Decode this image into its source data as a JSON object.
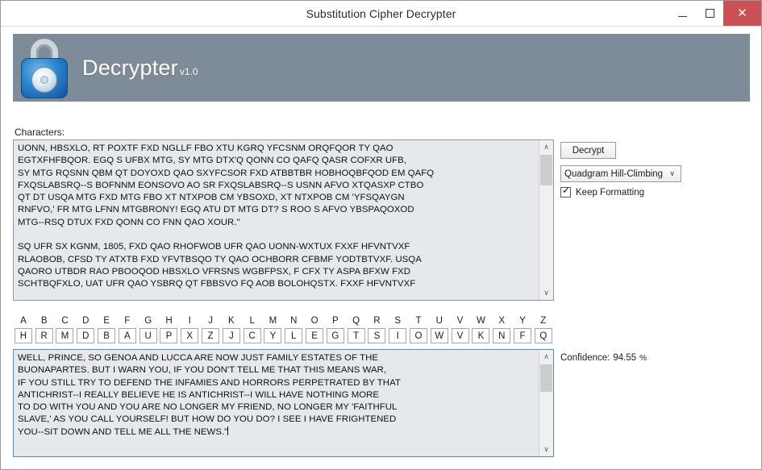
{
  "window": {
    "title": "Substitution Cipher Decrypter",
    "minimize_label": "–",
    "maximize_label": "",
    "close_label": "✕"
  },
  "banner": {
    "app_name": "Decrypter",
    "version": "v1.0",
    "bg_color": "#7e8c99",
    "lock_color": "#2b86cf"
  },
  "labels": {
    "characters": "Characters:"
  },
  "cipher": {
    "text": "UONN, HBSXLO, RT POXTF FXD NGLLF FBO XTU KGRQ YFCSNM ORQFQOR TY QAO\nEGTXFHFBQOR. EGQ S UFBX MTG, SY MTG DTX'Q QONN CO QAFQ QASR COFXR UFB,\nSY MTG RQSNN QBM QT DOYOXD QAO SXYFCSOR FXD ATBBTBR HOBHOQBFQOD EM QAFQ\nFXQSLABSRQ--S BOFNNM EONSOVO AO SR FXQSLABSRQ--S USNN AFVO XTQASXP CTBO\nQT DT USQA MTG FXD MTG FBO XT NTXPOB CM YBSOXD, XT NTXPOB CM 'YFSQAYGN\nRNFVO,' FR MTG LFNN MTGBRONY! EGQ ATU DT MTG DT? S ROO S AFVO YBSPAQOXOD\nMTG--RSQ DTUX FXD QONN CO FNN QAO XOUR.\"\n\nSQ UFR SX KGNM, 1805, FXD QAO RHOFWOB UFR QAO UONN-WXTUX FXXF HFVNTVXF\nRLAOBOB, CFSD TY ATXTB FXD YFVTBSQO TY QAO OCHBORR CFBMF YODTBTVXF. USQA\nQAORO UTBDR RAO PBOOQOD HBSXLO VFRSNS WGBFPSX, F CFX TY ASPA BFXW FXD\nSCHTBQFXLO, UAT UFR QAO YSBRQ QT FBBSVO FQ AOB BOLOHQSTX. FXXF HFVNTVXF",
    "scroll_thumb_position": "top"
  },
  "plain": {
    "text": "WELL, PRINCE, SO GENOA AND LUCCA ARE NOW JUST FAMILY ESTATES OF THE\nBUONAPARTES. BUT I WARN YOU, IF YOU DON'T TELL ME THAT THIS MEANS WAR,\nIF YOU STILL TRY TO DEFEND THE INFAMIES AND HORRORS PERPETRATED BY THAT\nANTICHRIST--I REALLY BELIEVE HE IS ANTICHRIST--I WILL HAVE NOTHING MORE\nTO DO WITH YOU AND YOU ARE NO LONGER MY FRIEND, NO LONGER MY 'FAITHFUL\nSLAVE,' AS YOU CALL YOURSELF! BUT HOW DO YOU DO? I SEE I HAVE FRIGHTENED\nYOU--SIT DOWN AND TELL ME ALL THE NEWS.\""
  },
  "alphabet": {
    "plain": [
      "A",
      "B",
      "C",
      "D",
      "E",
      "F",
      "G",
      "H",
      "I",
      "J",
      "K",
      "L",
      "M",
      "N",
      "O",
      "P",
      "Q",
      "R",
      "S",
      "T",
      "U",
      "V",
      "W",
      "X",
      "Y",
      "Z"
    ],
    "cipher": [
      "H",
      "R",
      "M",
      "D",
      "B",
      "A",
      "U",
      "P",
      "X",
      "Z",
      "J",
      "C",
      "Y",
      "L",
      "E",
      "G",
      "T",
      "S",
      "I",
      "O",
      "W",
      "V",
      "K",
      "N",
      "F",
      "Q"
    ]
  },
  "controls": {
    "decrypt_label": "Decrypt",
    "algorithm_selected": "Quadgram Hill-Climbing",
    "algorithm_options": [
      "Quadgram Hill-Climbing"
    ],
    "keep_formatting_label": "Keep Formatting",
    "keep_formatting_checked": true,
    "caret_glyph": "∨",
    "check_glyph": "✓"
  },
  "status": {
    "confidence_label": "Confidence:",
    "confidence_value": "94.55",
    "confidence_unit": "%"
  },
  "scroll": {
    "up_glyph": "∧",
    "down_glyph": "∨"
  }
}
